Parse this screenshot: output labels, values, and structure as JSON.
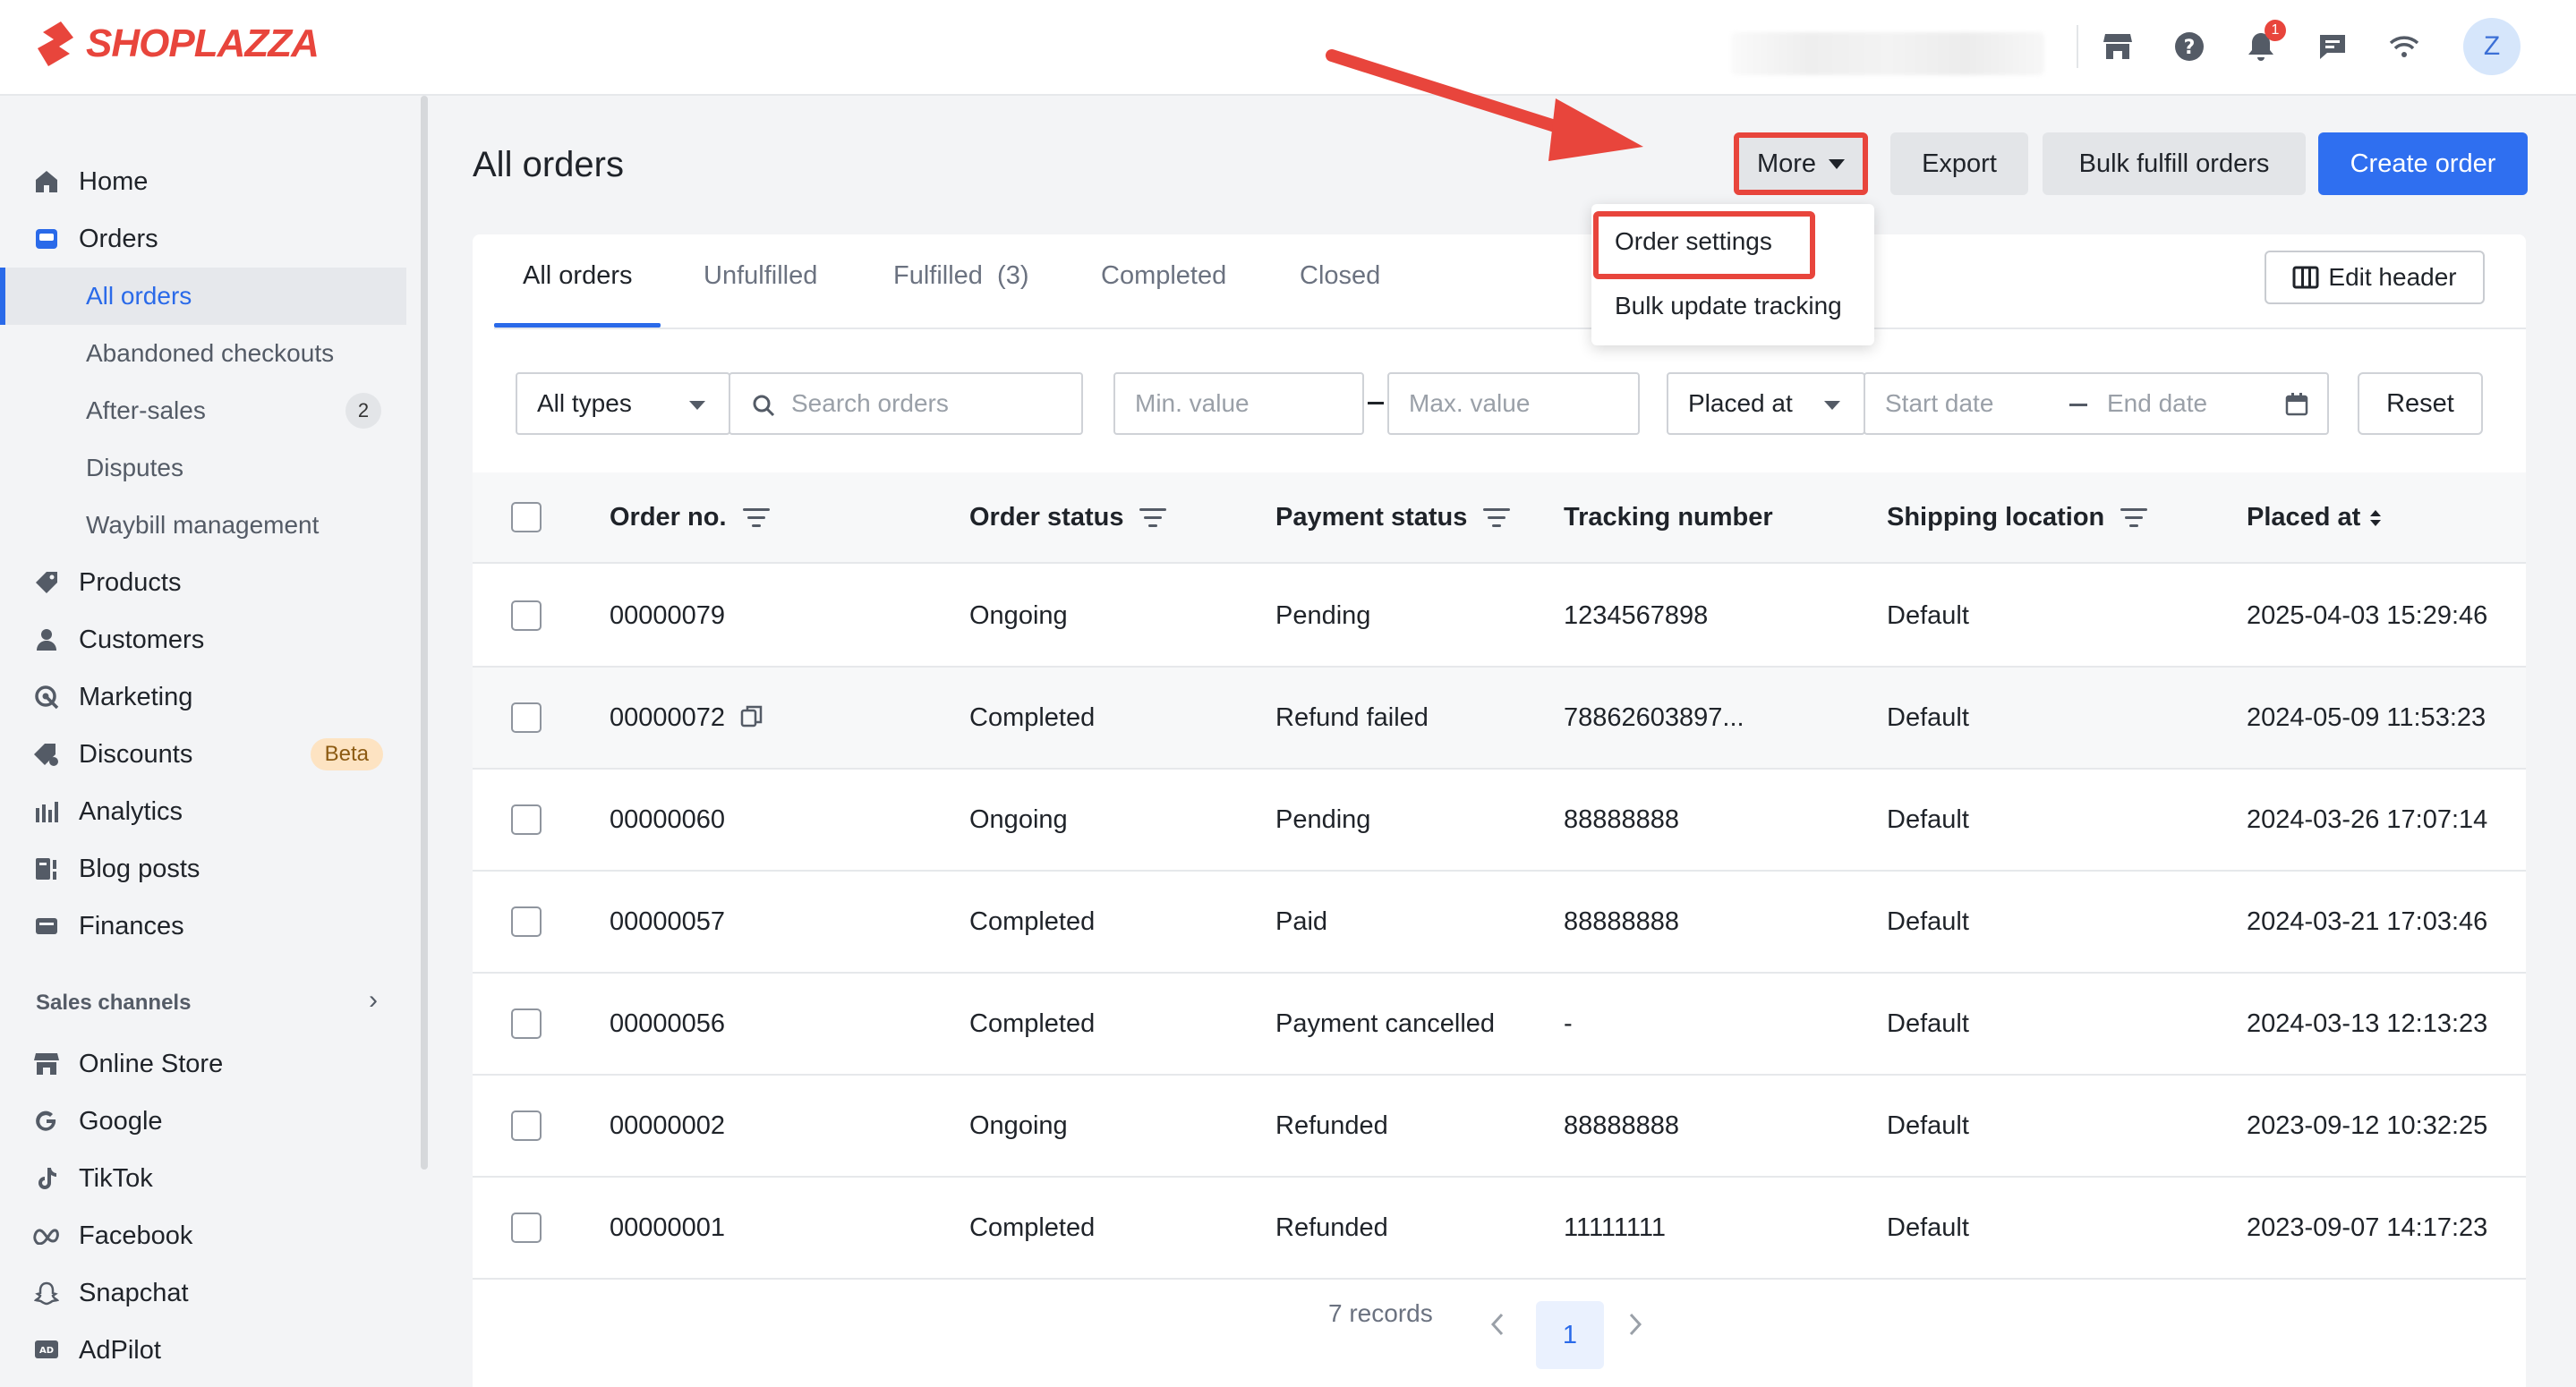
{
  "brand": {
    "name": "SHOPLAZZA",
    "accent": "#e8453c",
    "primary": "#2f6ff0"
  },
  "topbar": {
    "icons": [
      "store-icon",
      "help-icon",
      "bell-icon",
      "chat-icon",
      "wifi-icon"
    ],
    "notification_count": "1",
    "avatar_letter": "Z"
  },
  "sidebar": {
    "items": [
      {
        "label": "Home",
        "icon": "home-icon"
      },
      {
        "label": "Orders",
        "icon": "orders-icon"
      },
      {
        "label": "Products",
        "icon": "tag-icon"
      },
      {
        "label": "Customers",
        "icon": "person-icon"
      },
      {
        "label": "Marketing",
        "icon": "target-icon"
      },
      {
        "label": "Discounts",
        "icon": "discount-icon",
        "badge": "Beta"
      },
      {
        "label": "Analytics",
        "icon": "bar-chart-icon"
      },
      {
        "label": "Blog posts",
        "icon": "blog-icon"
      },
      {
        "label": "Finances",
        "icon": "wallet-icon"
      }
    ],
    "order_subitems": [
      {
        "label": "All orders",
        "active": true
      },
      {
        "label": "Abandoned checkouts"
      },
      {
        "label": "After-sales",
        "count": "2"
      },
      {
        "label": "Disputes"
      },
      {
        "label": "Waybill management"
      }
    ],
    "sales_channels_title": "Sales channels",
    "channels": [
      {
        "label": "Online Store",
        "icon": "store-icon"
      },
      {
        "label": "Google",
        "icon": "google-icon"
      },
      {
        "label": "TikTok",
        "icon": "tiktok-icon"
      },
      {
        "label": "Facebook",
        "icon": "meta-icon"
      },
      {
        "label": "Snapchat",
        "icon": "snapchat-icon"
      },
      {
        "label": "AdPilot",
        "icon": "adpilot-icon"
      }
    ]
  },
  "page": {
    "title": "All orders",
    "buttons": {
      "more": "More",
      "export": "Export",
      "bulk_fulfill": "Bulk fulfill orders",
      "create": "Create order"
    },
    "more_menu": [
      "Order settings",
      "Bulk update tracking"
    ]
  },
  "tabs": [
    "All orders",
    "Unfulfilled",
    "Fulfilled  (3)",
    "Completed",
    "Closed"
  ],
  "edit_header_label": "Edit header",
  "filters": {
    "type": "All types",
    "search_placeholder": "Search orders",
    "min_placeholder": "Min. value",
    "max_placeholder": "Max. value",
    "date_field": "Placed at",
    "start_placeholder": "Start date",
    "end_placeholder": "End date",
    "reset": "Reset"
  },
  "table": {
    "headers": [
      "Order no.",
      "Order status",
      "Payment status",
      "Tracking number",
      "Shipping location",
      "Placed at"
    ],
    "rows": [
      [
        "00000079",
        "Ongoing",
        "Pending",
        "1234567898",
        "Default",
        "2025-04-03 15:29:46"
      ],
      [
        "00000072",
        "Completed",
        "Refund failed",
        "78862603897...",
        "Default",
        "2024-05-09 11:53:23"
      ],
      [
        "00000060",
        "Ongoing",
        "Pending",
        "88888888",
        "Default",
        "2024-03-26 17:07:14"
      ],
      [
        "00000057",
        "Completed",
        "Paid",
        "88888888",
        "Default",
        "2024-03-21 17:03:46"
      ],
      [
        "00000056",
        "Completed",
        "Payment cancelled",
        "-",
        "Default",
        "2024-03-13 12:13:23"
      ],
      [
        "00000002",
        "Ongoing",
        "Refunded",
        "88888888",
        "Default",
        "2023-09-12 10:32:25"
      ],
      [
        "00000001",
        "Completed",
        "Refunded",
        "11111111",
        "Default",
        "2023-09-07 14:17:23"
      ]
    ]
  },
  "pagination": {
    "records": "7 records",
    "current_page": "1"
  }
}
